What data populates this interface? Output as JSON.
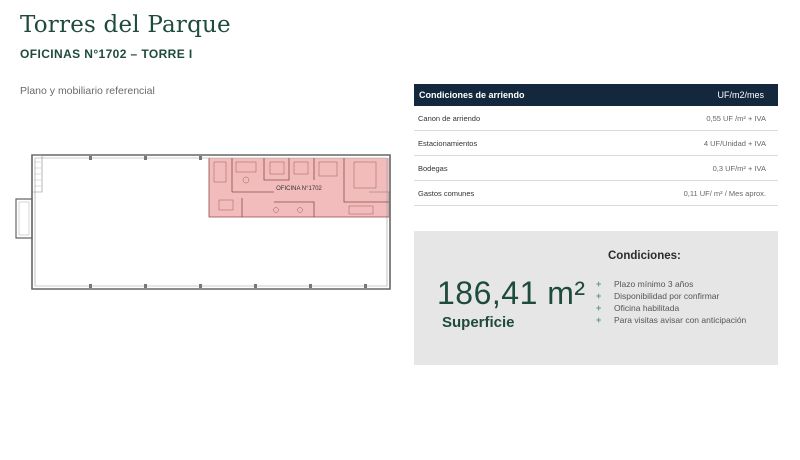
{
  "header": {
    "title": "Torres del Parque",
    "subtitle": "OFICINAS N°1702 – TORRE I"
  },
  "plan": {
    "caption": "Plano y mobiliario referencial",
    "office_label": "OFICINA N°1702",
    "highlight_color": "#f2b5b5"
  },
  "conditions_table": {
    "header_left": "Condiciones de arriendo",
    "header_right": "UF/m2/mes",
    "rows": [
      {
        "label": "Canon de arriendo",
        "value": "0,55 UF /m² + IVA"
      },
      {
        "label": "Estacionamientos",
        "value": "4 UF/Unidad + IVA"
      },
      {
        "label": "Bodegas",
        "value": "0,3 UF/m² + IVA"
      },
      {
        "label": "Gastos comunes",
        "value": "0,11 UF/ m² / Mes aprox."
      }
    ]
  },
  "surface": {
    "value": "186,41 m²",
    "label": "Superficie"
  },
  "conditions": {
    "title": "Condiciones:",
    "items": [
      "Plazo mínimo 3 años",
      "Disponibilidad por confirmar",
      "Oficina habilitada",
      "Para visitas avisar con anticipación"
    ]
  },
  "colors": {
    "brand_green": "#1f4a3e",
    "header_navy": "#13283d",
    "panel_gray": "#e6e6e6",
    "bullet_green": "#5f9b83"
  }
}
